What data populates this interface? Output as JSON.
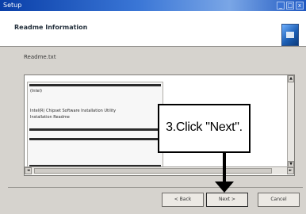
{
  "window": {
    "title": "Setup",
    "controls": [
      "_",
      "□",
      "x"
    ]
  },
  "header": {
    "title": "Readme Information",
    "icon": "setup-icon"
  },
  "section": {
    "label": "Readme.txt"
  },
  "infobox": {
    "lines": [
      "(Intel)",
      "Intel(R) Chipset Software Installation Utility",
      "Installation Readme"
    ]
  },
  "scrollbars": {
    "up": "▲",
    "down": "▼",
    "left": "◄",
    "right": "►"
  },
  "buttons": {
    "back": "< Back",
    "next": "Next >",
    "cancel": "Cancel"
  },
  "callout": {
    "text": "3.Click \"Next\"."
  }
}
